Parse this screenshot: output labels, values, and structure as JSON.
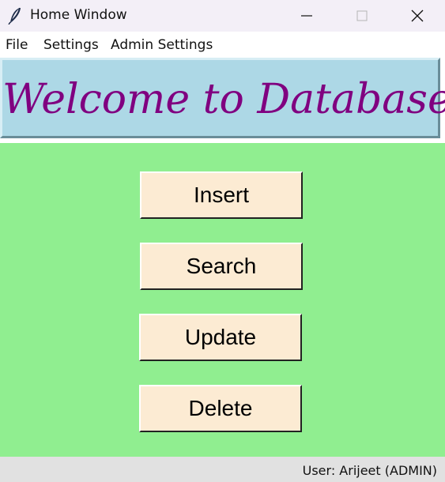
{
  "window": {
    "title": "Home Window",
    "icon": "feather-icon"
  },
  "menu": {
    "items": [
      {
        "label": "File"
      },
      {
        "label": "Settings"
      },
      {
        "label": "Admin Settings"
      }
    ]
  },
  "banner": {
    "text": "Welcome to Database",
    "text_color": "#800080",
    "background": "#add8e6"
  },
  "actions": {
    "insert_label": "Insert",
    "search_label": "Search",
    "update_label": "Update",
    "delete_label": "Delete",
    "background": "#90ee90",
    "button_color": "#fcebd3"
  },
  "status": {
    "user_text": "User: Arijeet (ADMIN)"
  }
}
